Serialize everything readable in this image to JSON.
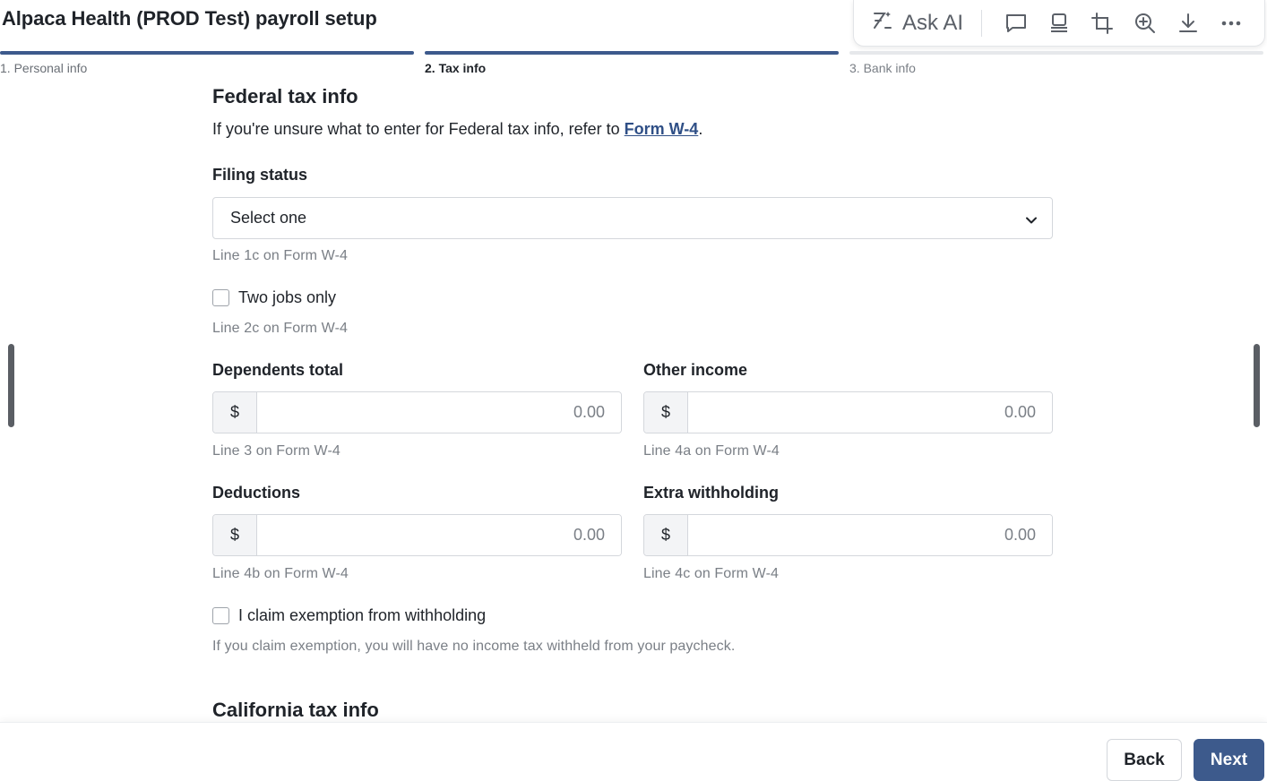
{
  "header": {
    "title": "Alpaca Health (PROD Test) payroll setup"
  },
  "toolbar": {
    "ask_ai_label": "Ask AI",
    "icons": [
      "comment-icon",
      "stamp-icon",
      "crop-icon",
      "zoom-in-icon",
      "download-icon",
      "more-icon"
    ]
  },
  "stepper": {
    "steps": [
      {
        "label": "1. Personal info",
        "state": "complete"
      },
      {
        "label": "2. Tax info",
        "state": "current"
      },
      {
        "label": "3. Bank info",
        "state": "upcoming"
      }
    ]
  },
  "federal": {
    "title": "Federal tax info",
    "intro_text": "If you're unsure what to enter for Federal tax info, refer to ",
    "intro_link": "Form W-4",
    "intro_end": ".",
    "filing_status": {
      "label": "Filing status",
      "value": "Select one",
      "hint": "Line 1c on Form W-4"
    },
    "two_jobs": {
      "label": "Two jobs only",
      "checked": false,
      "hint": "Line 2c on Form W-4"
    },
    "dependents": {
      "label": "Dependents total",
      "prefix": "$",
      "placeholder": "0.00",
      "hint": "Line 3 on Form W-4"
    },
    "other_income": {
      "label": "Other income",
      "prefix": "$",
      "placeholder": "0.00",
      "hint": "Line 4a on Form W-4"
    },
    "deductions": {
      "label": "Deductions",
      "prefix": "$",
      "placeholder": "0.00",
      "hint": "Line 4b on Form W-4"
    },
    "extra_withholding": {
      "label": "Extra withholding",
      "prefix": "$",
      "placeholder": "0.00",
      "hint": "Line 4c on Form W-4"
    },
    "exemption": {
      "label": "I claim exemption from withholding",
      "checked": false,
      "hint": "If you claim exemption, you will have no income tax withheld from your paycheck."
    }
  },
  "california": {
    "title": "California tax info"
  },
  "footer": {
    "back_label": "Back",
    "next_label": "Next"
  },
  "colors": {
    "accent": "#3d5a8c",
    "link": "#2f4f86",
    "hint": "#7a7f86",
    "track": "#e6e8eb"
  }
}
